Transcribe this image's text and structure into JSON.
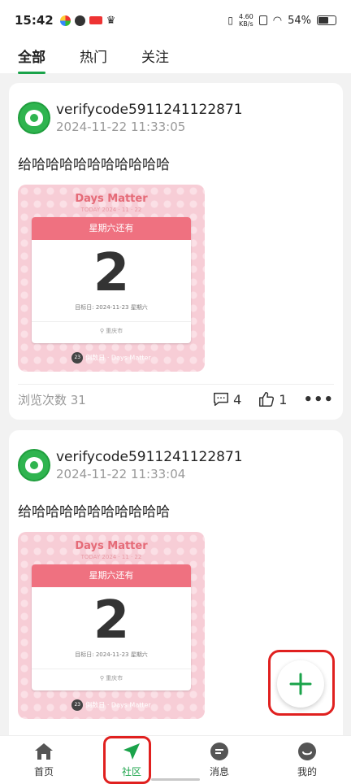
{
  "status_bar": {
    "time": "15:42",
    "net_speed_value": "4.60",
    "net_speed_unit": "KB/s",
    "battery_text": "54%",
    "battery_level": 0.54
  },
  "tabs": [
    {
      "label": "全部",
      "active": true
    },
    {
      "label": "热门",
      "active": false
    },
    {
      "label": "关注",
      "active": false
    }
  ],
  "posts": [
    {
      "username": "verifycode5911241122871",
      "time": "2024-11-22 11:33:05",
      "text": "给哈哈哈哈哈哈哈哈哈哈",
      "image": {
        "title": "Days Matter",
        "subtitle": "TODAY 2024 · 11 · 22",
        "card_header": "星期六还有",
        "number": "2",
        "target": "目标日: 2024-11-23 星期六",
        "city": "重庆市",
        "footer": "倒数日 · Days Matter",
        "badge": "23"
      },
      "views": "浏览次数 31",
      "comments": "4",
      "likes": "1",
      "more": "•••"
    },
    {
      "username": "verifycode5911241122871",
      "time": "2024-11-22 11:33:04",
      "text": "给哈哈哈哈哈哈哈哈哈哈",
      "image": {
        "title": "Days Matter",
        "subtitle": "TODAY 2024 · 11 · 22",
        "card_header": "星期六还有",
        "number": "2",
        "target": "目标日: 2024-11-23 星期六",
        "city": "重庆市",
        "footer": "倒数日 · Days Matter",
        "badge": "23"
      }
    }
  ],
  "fab_label": "+",
  "bottom_nav": [
    {
      "label": "首页",
      "icon": "home-icon",
      "active": false
    },
    {
      "label": "社区",
      "icon": "send-icon",
      "active": true
    },
    {
      "label": "消息",
      "icon": "message-icon",
      "active": false
    },
    {
      "label": "我的",
      "icon": "profile-icon",
      "active": false
    }
  ],
  "colors": {
    "accent": "#1aa34a",
    "highlight_ring": "#e0201f"
  }
}
